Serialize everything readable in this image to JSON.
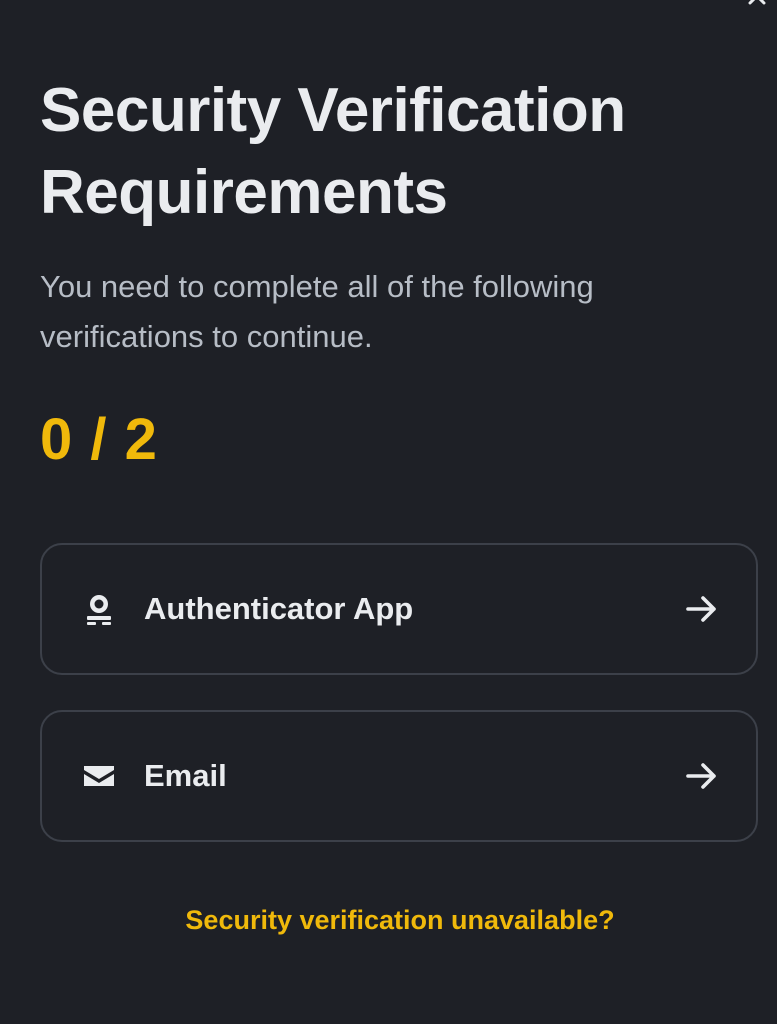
{
  "header": {
    "title": "Security Verification Requirements",
    "subtitle": "You need to complete all of the following verifications to continue."
  },
  "progress": {
    "text": "0 / 2",
    "completed": 0,
    "total": 2
  },
  "options": [
    {
      "label": "Authenticator App",
      "icon": "authenticator-icon"
    },
    {
      "label": "Email",
      "icon": "email-icon"
    }
  ],
  "footer": {
    "help_link": "Security verification unavailable?"
  },
  "colors": {
    "background": "#1e2026",
    "accent": "#f0b90b",
    "text_primary": "#eaecef",
    "text_secondary": "#b7bdc6",
    "border": "#3c4049"
  }
}
